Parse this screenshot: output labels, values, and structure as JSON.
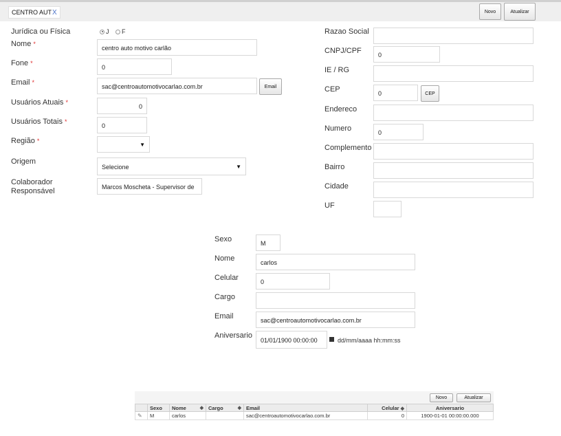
{
  "tabs": [
    {
      "label": "CENTRO AUT",
      "close": "X"
    }
  ],
  "toolbar": {
    "novo": "Novo",
    "atualizar": "Atualizar"
  },
  "company": {
    "tipo": {
      "label": "Jurídica ou Física",
      "options": [
        "J",
        "F"
      ],
      "selected": "J"
    },
    "nome": {
      "label": "Nome",
      "value": "centro auto motivo carlão"
    },
    "fone": {
      "label": "Fone",
      "value": "0"
    },
    "email": {
      "label": "Email",
      "value": "sac@centroautomotivocarlao.com.br",
      "button": "Email"
    },
    "usuarios_atuais": {
      "label": "Usuários Atuais",
      "value": "0"
    },
    "usuarios_totais": {
      "label": "Usuários Totais",
      "value": "0"
    },
    "regiao": {
      "label": "Região",
      "value": ""
    },
    "origem": {
      "label": "Origem",
      "value": "Selecione"
    },
    "colaborador": {
      "label_line1": "Colaborador",
      "label_line2": "Responsável",
      "value": "Marcos Moscheta - Supervisor de"
    },
    "required_mark": "*"
  },
  "address": {
    "razao_social": {
      "label": "Razao Social",
      "value": ""
    },
    "cnpj": {
      "label": "CNPJ/CPF",
      "value": "0"
    },
    "ie_rg": {
      "label": "IE / RG",
      "value": ""
    },
    "cep": {
      "label": "CEP",
      "value": "0",
      "button": "CEP"
    },
    "endereco": {
      "label": "Endereco",
      "value": ""
    },
    "numero": {
      "label": "Numero",
      "value": "0"
    },
    "complemento": {
      "label": "Complemento",
      "value": ""
    },
    "bairro": {
      "label": "Bairro",
      "value": ""
    },
    "cidade": {
      "label": "Cidade",
      "value": ""
    },
    "uf": {
      "label": "UF",
      "value": ""
    }
  },
  "contact": {
    "sexo": {
      "label": "Sexo",
      "value": "M"
    },
    "nome": {
      "label": "Nome",
      "value": "carlos"
    },
    "celular": {
      "label": "Celular",
      "value": "0"
    },
    "cargo": {
      "label": "Cargo",
      "value": ""
    },
    "email": {
      "label": "Email",
      "value": "sac@centroautomotivocarlao.com.br"
    },
    "aniversario": {
      "label": "Aniversario",
      "value": "01/01/1900 00:00:00",
      "hint": "dd/mm/aaaa hh:mm:ss"
    }
  },
  "contacts_grid": {
    "toolbar": {
      "novo": "Novo",
      "atualizar": "Atualizar"
    },
    "columns": [
      "Sexo",
      "Nome",
      "Cargo",
      "Email",
      "Celular",
      "Aniversario"
    ],
    "rows": [
      {
        "sexo": "M",
        "nome": "carlos",
        "cargo": "",
        "email": "sac@centroautomotivocarlao.com.br",
        "celular": "0",
        "aniversario": "1900-01-01 00:00:00.000"
      }
    ]
  },
  "icons": {
    "sort": "sort-updown-icon",
    "edit": "pencil-icon",
    "calendar": "calendar-icon",
    "dropdown": "caret-down-icon"
  }
}
